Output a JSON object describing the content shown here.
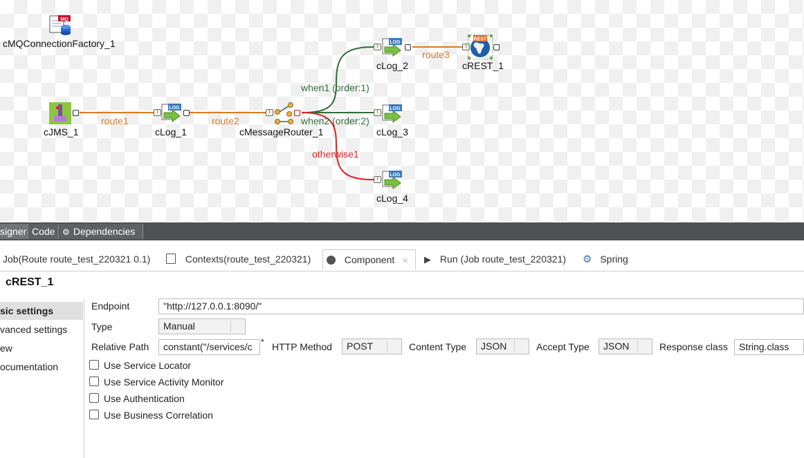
{
  "diagram": {
    "nodes": {
      "factory": "cMQConnectionFactory_1",
      "jms": "cJMS_1",
      "log1": "cLog_1",
      "router": "cMessageRouter_1",
      "log2": "cLog_2",
      "rest": "cREST_1",
      "log3": "cLog_3",
      "log4": "cLog_4"
    },
    "links": {
      "route1": "route1",
      "route2": "route2",
      "route3": "route3",
      "when1": "when1 (order:1)",
      "when2": "when2 (order:2)",
      "otherwise": "otherwise1"
    },
    "icon_text": {
      "mq": "MQ",
      "log": "LOG",
      "rest": "REST"
    },
    "colors": {
      "route": "#d97a1f",
      "when": "#2f6b39",
      "otherwise": "#e02020"
    }
  },
  "designer_tabs": [
    "signer",
    "Code",
    "Dependencies"
  ],
  "view_tabs": {
    "job": "Job(Route route_test_220321 0.1)",
    "contexts": "Contexts(route_test_220321)",
    "component": "Component",
    "run": "Run (Job route_test_220321)",
    "spring": "Spring"
  },
  "component_title": "cREST_1",
  "left_menu": [
    "sic settings",
    "vanced settings",
    "ew",
    "ocumentation"
  ],
  "form": {
    "endpoint_label": "Endpoint",
    "endpoint_value": "\"http://127.0.0.1:8090/\"",
    "type_label": "Type",
    "type_value": "Manual",
    "relative_path_label": "Relative Path",
    "relative_path_value": "constant(\"/services/c",
    "required_marker": "*",
    "http_method_label": "HTTP Method",
    "http_method_value": "POST",
    "content_type_label": "Content Type",
    "content_type_value": "JSON",
    "accept_type_label": "Accept Type",
    "accept_type_value": "JSON",
    "response_class_label": "Response class",
    "response_class_value": "String.class"
  },
  "checkboxes": [
    "Use Service Locator",
    "Use Service Activity Monitor",
    "Use Authentication",
    "Use Business Correlation"
  ]
}
